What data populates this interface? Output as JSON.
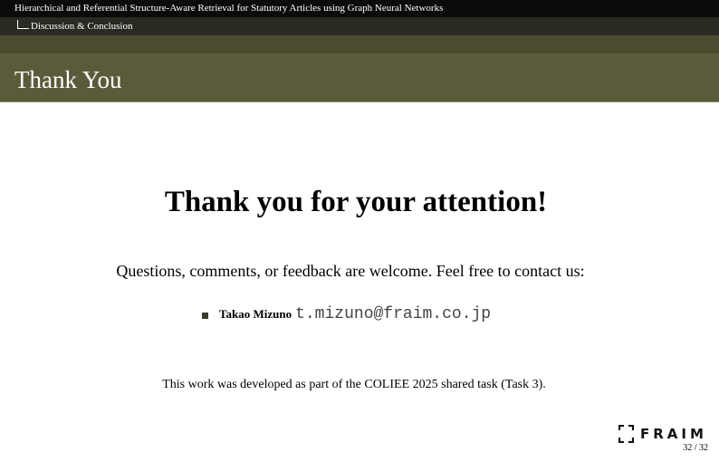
{
  "header": {
    "presentation_title": "Hierarchical and Referential Structure-Aware Retrieval for Statutory Articles using Graph Neural Networks",
    "section": "Discussion & Conclusion"
  },
  "frame": {
    "title": "Thank You"
  },
  "main": {
    "heading": "Thank you for your attention!",
    "questions": "Questions, comments, or feedback are welcome. Feel free to contact us:",
    "contacts": [
      {
        "name": "Takao Mizuno",
        "email": "t.mizuno@fraim.co.jp"
      }
    ],
    "footnote": "This work was developed as part of the COLIEE 2025 shared task (Task 3)."
  },
  "footer": {
    "logo_text": "FRAIM",
    "page_number": "32 / 32"
  },
  "colors": {
    "top_bar": "#0b0b0b",
    "section_bar": "#2a2a22",
    "frame_title_bg": "#5b5b3c",
    "accent_band": "#4b4b30"
  }
}
